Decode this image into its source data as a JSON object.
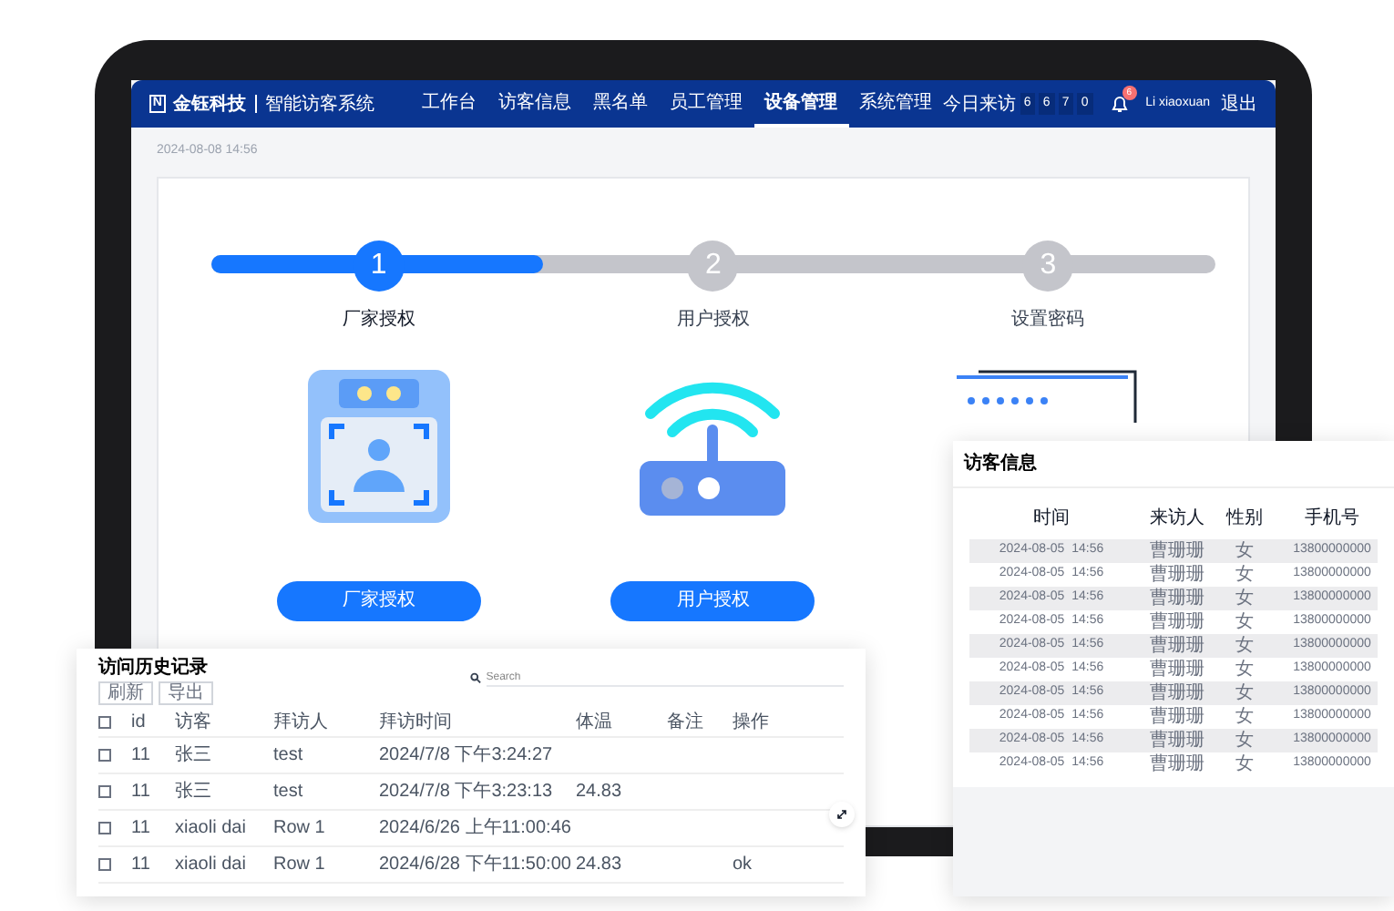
{
  "nav": {
    "logo_mark": "N",
    "brand": "金钰科技",
    "system": "智能访客系统",
    "items": [
      {
        "label": "工作台",
        "selected": false
      },
      {
        "label": "访客信息",
        "selected": false
      },
      {
        "label": "黑名单",
        "selected": false
      },
      {
        "label": "员工管理",
        "selected": false
      },
      {
        "label": "设备管理",
        "selected": true
      },
      {
        "label": "系统管理",
        "selected": false
      }
    ],
    "today_label": "今日来访",
    "today_digits": [
      "6",
      "6",
      "7",
      "0"
    ],
    "notification_badge": "6",
    "user": "Li xiaoxuan",
    "logout": "退出"
  },
  "timestamp": "2024-08-08 14:56",
  "stepper": {
    "level": 0.33,
    "steps": [
      {
        "number": "1",
        "label": "厂家授权",
        "selected": true,
        "kind": "face",
        "button": "厂家授权"
      },
      {
        "number": "2",
        "label": "用户授权",
        "selected": false,
        "kind": "router",
        "button": "用户授权"
      },
      {
        "number": "3",
        "label": "设置密码",
        "selected": false,
        "kind": "password"
      }
    ]
  },
  "visitor_card": {
    "title": "访客信息",
    "columns": [
      "时间",
      "来访人",
      "性别",
      "手机号"
    ],
    "rows": [
      [
        "2024-08-05  14:56",
        "曹珊珊",
        "女",
        "13800000000"
      ],
      [
        "2024-08-05  14:56",
        "曹珊珊",
        "女",
        "13800000000"
      ],
      [
        "2024-08-05  14:56",
        "曹珊珊",
        "女",
        "13800000000"
      ],
      [
        "2024-08-05  14:56",
        "曹珊珊",
        "女",
        "13800000000"
      ],
      [
        "2024-08-05  14:56",
        "曹珊珊",
        "女",
        "13800000000"
      ],
      [
        "2024-08-05  14:56",
        "曹珊珊",
        "女",
        "13800000000"
      ],
      [
        "2024-08-05  14:56",
        "曹珊珊",
        "女",
        "13800000000"
      ],
      [
        "2024-08-05  14:56",
        "曹珊珊",
        "女",
        "13800000000"
      ],
      [
        "2024-08-05  14:56",
        "曹珊珊",
        "女",
        "13800000000"
      ],
      [
        "2024-08-05  14:56",
        "曹珊珊",
        "女",
        "13800000000"
      ]
    ]
  },
  "history_card": {
    "title": "访问历史记录",
    "buttons": [
      "刷新",
      "导出"
    ],
    "search": {
      "placeholder": "Search"
    },
    "select_all_checked": false,
    "columns": [
      "id",
      "访客",
      "拜访人",
      "拜访时间",
      "体温",
      "备注",
      "操作"
    ],
    "rows": [
      {
        "checked": false,
        "cells": [
          "11",
          "张三",
          "test",
          "2024/7/8 下午3:24:27",
          "",
          "",
          ""
        ]
      },
      {
        "checked": false,
        "cells": [
          "11",
          "张三",
          "test",
          "2024/7/8 下午3:23:13",
          "24.83",
          "",
          ""
        ]
      },
      {
        "checked": false,
        "cells": [
          "11",
          "xiaoli dai",
          "Row 1",
          "2024/6/26 上午11:00:46",
          "",
          "",
          ""
        ]
      },
      {
        "checked": false,
        "cells": [
          "11",
          "xiaoli dai",
          "Row 1",
          "2024/6/28 下午11:50:00",
          "24.83",
          "",
          "ok"
        ]
      }
    ]
  }
}
